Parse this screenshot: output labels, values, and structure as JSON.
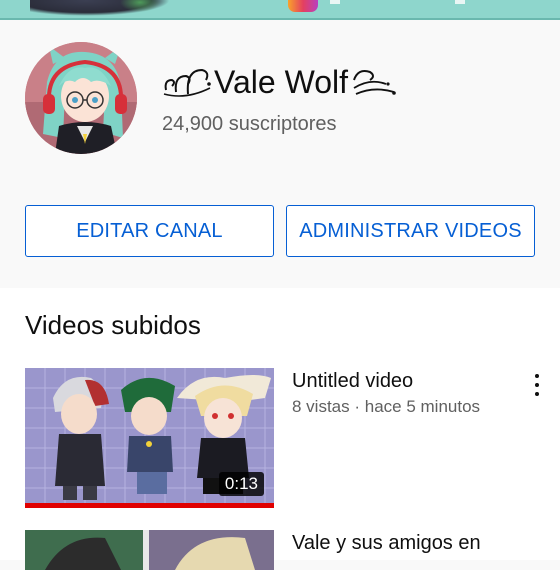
{
  "channel": {
    "name": "Vale Wolf",
    "subscribers": "24,900 suscriptores"
  },
  "buttons": {
    "edit_label": "EDITAR CANAL",
    "manage_label": "ADMINISTRAR VIDEOS"
  },
  "videos_section": {
    "title": "Videos subidos",
    "items": [
      {
        "title": "Untitled video",
        "meta": "8 vistas · hace 5 minutos",
        "duration": "0:13",
        "watched_fraction": 1.0
      },
      {
        "title": "Vale y sus amigos en"
      }
    ]
  },
  "colors": {
    "accent": "#065fd4",
    "banner": "#8ed6cc",
    "progress": "#e00000",
    "text_secondary": "#606060"
  },
  "icons": [
    "instagram-icon",
    "more-options-icon"
  ]
}
